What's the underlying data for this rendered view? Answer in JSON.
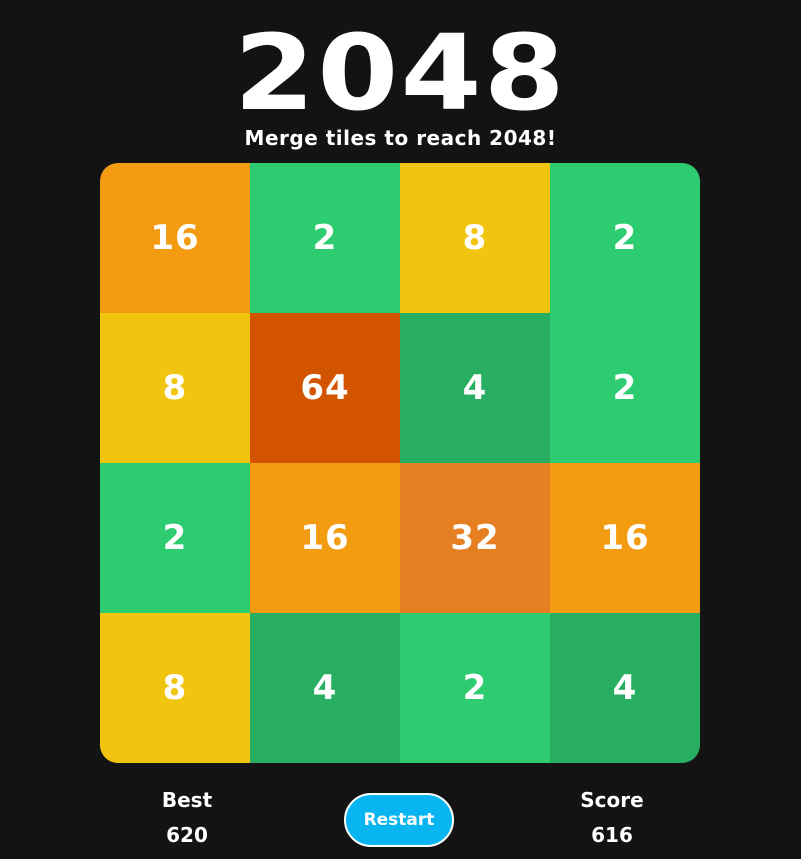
{
  "header": {
    "title": "2048",
    "subtitle": "Merge tiles to reach 2048!"
  },
  "board": {
    "size": 4,
    "rows": [
      [
        16,
        2,
        8,
        2
      ],
      [
        8,
        64,
        4,
        2
      ],
      [
        2,
        16,
        32,
        16
      ],
      [
        8,
        4,
        2,
        4
      ]
    ]
  },
  "tile_colors": {
    "2": "#2ecc71",
    "4": "#27ae60",
    "8": "#f1c40f",
    "16": "#f39c12",
    "32": "#e67e22",
    "64": "#d35400"
  },
  "stats": {
    "best_label": "Best",
    "best_value": "620",
    "score_label": "Score",
    "score_value": "616"
  },
  "controls": {
    "restart_label": "Restart",
    "restart_color": "#08b5f1"
  },
  "colors": {
    "background": "#131313",
    "text": "#ffffff"
  }
}
